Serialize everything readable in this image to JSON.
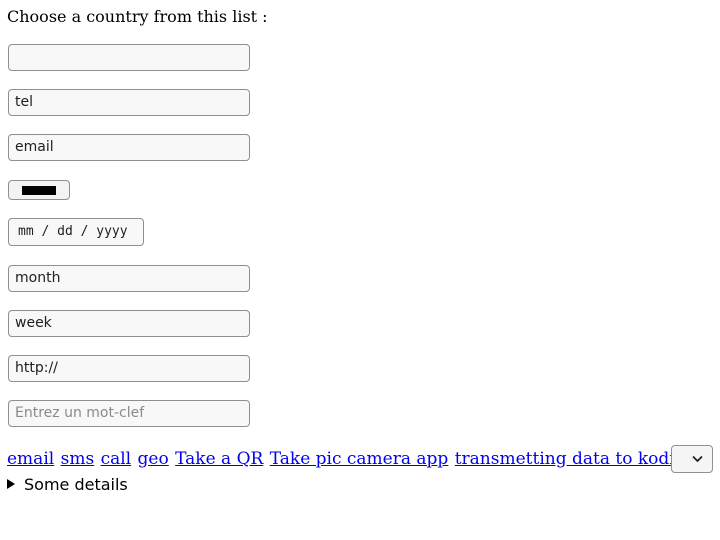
{
  "prompt": "Choose a country from this list :",
  "fields": {
    "country": {
      "value": ""
    },
    "tel": {
      "value": "tel"
    },
    "email": {
      "value": "email"
    },
    "color": {
      "value": "#000000"
    },
    "date": {
      "value": "mm / dd / yyyy"
    },
    "month": {
      "value": "month"
    },
    "week": {
      "value": "week"
    },
    "url": {
      "value": "http://"
    },
    "search": {
      "placeholder": "Entrez un mot-clef"
    }
  },
  "links": [
    {
      "label": "email"
    },
    {
      "label": "sms"
    },
    {
      "label": "call"
    },
    {
      "label": "geo"
    },
    {
      "label": "Take a QR"
    },
    {
      "label": "Take pic camera app"
    },
    {
      "label": "transmetting data to kodi app"
    }
  ],
  "select": {
    "value": "",
    "icon": "chevron-down-icon"
  },
  "details": {
    "summary": "Some details"
  },
  "colors": {
    "link": "#0000ee",
    "border": "#8f8f8f",
    "field_bg": "#f8f8f8"
  }
}
